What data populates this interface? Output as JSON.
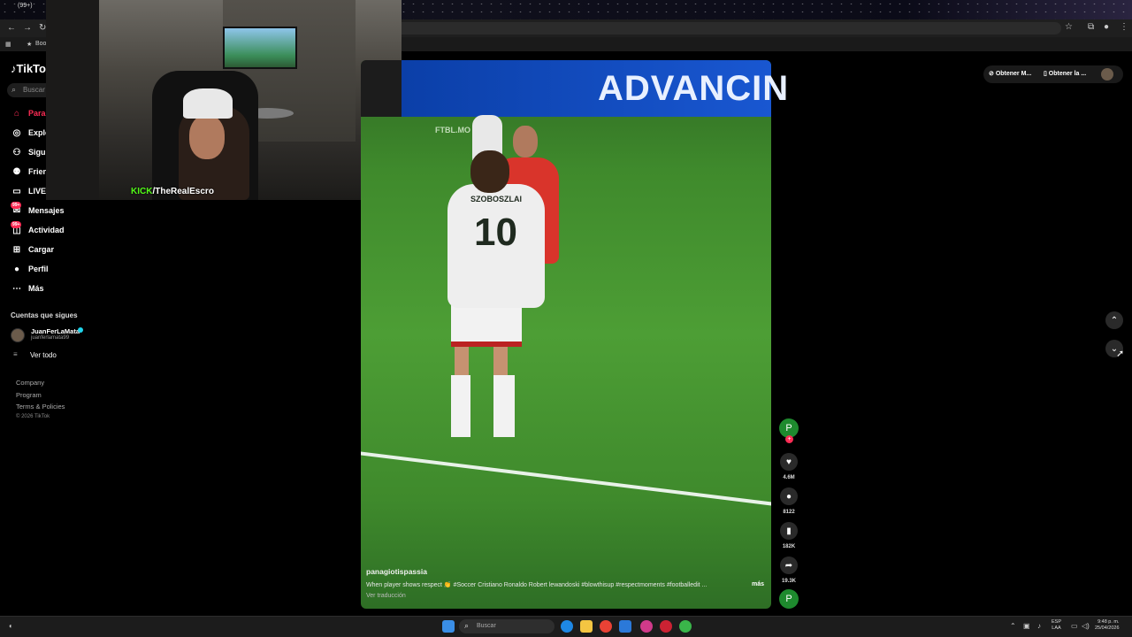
{
  "browser": {
    "tab_title": "(99+) ",
    "bookmarks_label": "Book"
  },
  "tiktok": {
    "logo": "TikTo",
    "search_placeholder": "Buscar",
    "nav": [
      {
        "label": "Para ti",
        "icon": "home-icon",
        "active": true
      },
      {
        "label": "Explo",
        "icon": "compass-icon"
      },
      {
        "label": "Sigui",
        "icon": "following-icon"
      },
      {
        "label": "Frien",
        "icon": "friends-icon"
      },
      {
        "label": "LIVE",
        "icon": "live-icon"
      },
      {
        "label": "Mensajes",
        "icon": "message-icon",
        "badge": "99+"
      },
      {
        "label": "Actividad",
        "icon": "activity-icon",
        "badge": "99+"
      },
      {
        "label": "Cargar",
        "icon": "upload-icon"
      },
      {
        "label": "Perfil",
        "icon": "profile-icon"
      },
      {
        "label": "Más",
        "icon": "more-icon"
      }
    ],
    "following_title": "Cuentas que sigues",
    "account": {
      "name": "JuanFerLaMata",
      "handle": "juanferlamata99"
    },
    "see_all": "Ver todo",
    "footer": [
      "Company",
      "Program",
      "Terms & Policies"
    ],
    "copyright": "© 2026 TikTok"
  },
  "stream": {
    "kick": "KICK",
    "channel": "/TheRealEscro"
  },
  "video": {
    "ad_board": "ADVANCIN",
    "watermark": "FTBL.MO",
    "player_name": "SZOBOSZLAI",
    "player_number": "10",
    "author": "panagiotispassia",
    "caption": "When player shows respect 👏 #Soccer Cristiano Ronaldo Robert lewandoski #blowthisup #respectmoments #footballedit ...",
    "more": "más",
    "translate": "Ver traducción"
  },
  "actions": {
    "avatar_letter": "P",
    "likes": "4.6M",
    "comments": "8122",
    "saves": "182K",
    "shares": "19.3K"
  },
  "top_actions": {
    "get_app": "Obtener M...",
    "get_pc": "Obtener la ..."
  },
  "taskbar": {
    "search": "Buscar",
    "lang_1": "ESP",
    "lang_2": "LAA",
    "time": "9:48 p. m.",
    "date": "25/04/2026"
  }
}
